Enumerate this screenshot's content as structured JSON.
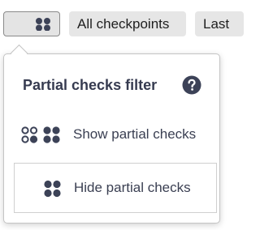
{
  "toolbar": {
    "toggle_icon": "four-dots-icon",
    "all_checkpoints_label": "All checkpoints",
    "last_label": "Last"
  },
  "popover": {
    "title": "Partial checks filter",
    "help_icon": "help-icon",
    "options": [
      {
        "label": "Show partial checks",
        "icon": "partial-and-full-dots-icon",
        "selected": false
      },
      {
        "label": "Hide partial checks",
        "icon": "full-dots-icon",
        "selected": true
      }
    ]
  },
  "colors": {
    "icon": "#3c4257",
    "pill_background": "#e6e6e6",
    "text": "#2f3447"
  }
}
